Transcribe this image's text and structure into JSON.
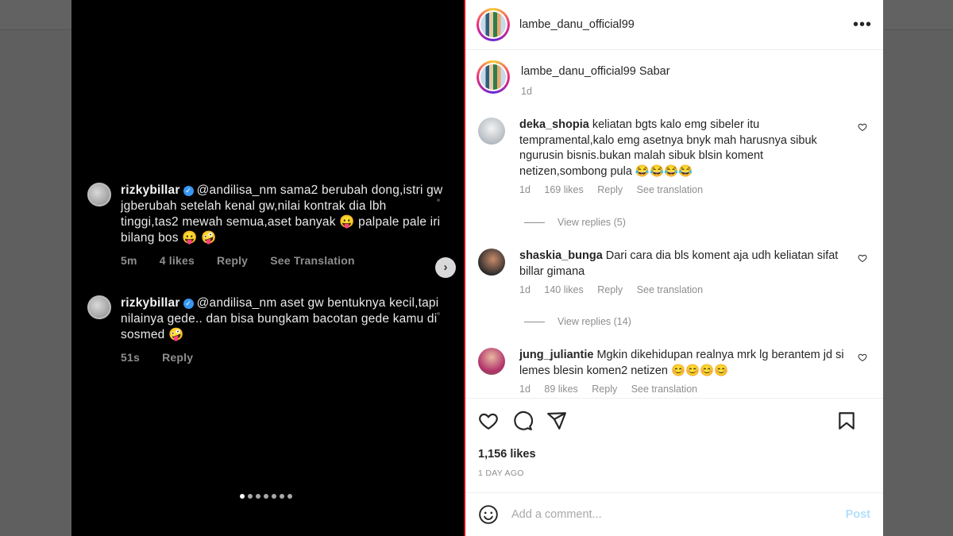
{
  "post": {
    "username": "lambe_danu_official99",
    "caption_user": "lambe_danu_official99",
    "caption_text": "Sabar",
    "caption_time": "1d",
    "likes": "1,156 likes",
    "time_ago": "1 DAY AGO",
    "add_comment_placeholder": "Add a comment...",
    "post_label": "Post"
  },
  "media": {
    "comments": [
      {
        "user": "rizkybillar",
        "text": "@andilisa_nm sama2 berubah dong,istri gw jgberubah setelah kenal gw,nilai kontrak dia lbh tinggi,tas2 mewah semua,aset banyak 😛 palpale pale iri bilang bos 😛 🤪",
        "time": "5m",
        "likes": "4 likes",
        "reply": "Reply",
        "translate": "See Translation"
      },
      {
        "user": "rizkybillar",
        "text": "@andilisa_nm aset gw bentuknya kecil,tapi nilainya gede.. dan bisa bungkam bacotan gede kamu di sosmed 🤪",
        "time": "51s",
        "reply": "Reply"
      }
    ]
  },
  "comments": [
    {
      "user": "deka_shopia",
      "text": "keliatan bgts kalo emg sibeler itu tempramental,kalo emg asetnya bnyk mah harusnya sibuk ngurusin bisnis.bukan malah sibuk blsin koment netizen,sombong pula 😂😂😂😂",
      "time": "1d",
      "likes": "169 likes",
      "reply": "Reply",
      "translate": "See translation",
      "view_replies": "View replies (5)"
    },
    {
      "user": "shaskia_bunga",
      "text": "Dari cara dia bls koment aja udh keliatan sifat billar gimana",
      "time": "1d",
      "likes": "140 likes",
      "reply": "Reply",
      "translate": "See translation",
      "view_replies": "View replies (14)"
    },
    {
      "user": "jung_juliantie",
      "text": "Mgkin dikehidupan realnya mrk lg berantem jd si lemes blesin komen2 netizen 😊😊😊😊",
      "time": "1d",
      "likes": "89 likes",
      "reply": "Reply",
      "translate": "See translation"
    }
  ],
  "icons": {
    "more": "more-icon",
    "heart": "heart-icon",
    "comment": "comment-icon",
    "share": "share-icon",
    "bookmark": "bookmark-icon",
    "emoji": "emoji-icon",
    "next": "chevron-right-icon"
  },
  "carousel": {
    "count": 7,
    "active": 1
  },
  "colors": {
    "accent": "#0095f6",
    "post_disabled": "#b2dffc",
    "verified": "#3897f0"
  }
}
